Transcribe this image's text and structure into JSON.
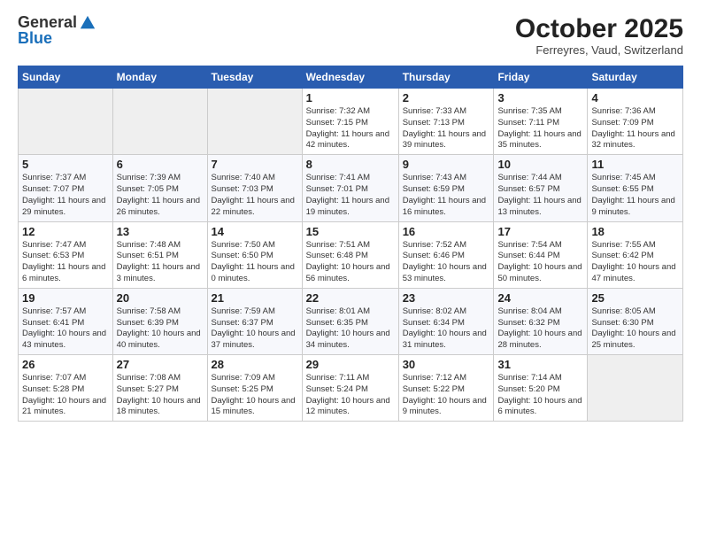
{
  "header": {
    "logo_general": "General",
    "logo_blue": "Blue",
    "month_title": "October 2025",
    "subtitle": "Ferreyres, Vaud, Switzerland"
  },
  "weekdays": [
    "Sunday",
    "Monday",
    "Tuesday",
    "Wednesday",
    "Thursday",
    "Friday",
    "Saturday"
  ],
  "weeks": [
    [
      {
        "day": "",
        "empty": true
      },
      {
        "day": "",
        "empty": true
      },
      {
        "day": "",
        "empty": true
      },
      {
        "day": "1",
        "sunrise": "7:32 AM",
        "sunset": "7:15 PM",
        "daylight": "11 hours and 42 minutes."
      },
      {
        "day": "2",
        "sunrise": "7:33 AM",
        "sunset": "7:13 PM",
        "daylight": "11 hours and 39 minutes."
      },
      {
        "day": "3",
        "sunrise": "7:35 AM",
        "sunset": "7:11 PM",
        "daylight": "11 hours and 35 minutes."
      },
      {
        "day": "4",
        "sunrise": "7:36 AM",
        "sunset": "7:09 PM",
        "daylight": "11 hours and 32 minutes."
      }
    ],
    [
      {
        "day": "5",
        "sunrise": "7:37 AM",
        "sunset": "7:07 PM",
        "daylight": "11 hours and 29 minutes."
      },
      {
        "day": "6",
        "sunrise": "7:39 AM",
        "sunset": "7:05 PM",
        "daylight": "11 hours and 26 minutes."
      },
      {
        "day": "7",
        "sunrise": "7:40 AM",
        "sunset": "7:03 PM",
        "daylight": "11 hours and 22 minutes."
      },
      {
        "day": "8",
        "sunrise": "7:41 AM",
        "sunset": "7:01 PM",
        "daylight": "11 hours and 19 minutes."
      },
      {
        "day": "9",
        "sunrise": "7:43 AM",
        "sunset": "6:59 PM",
        "daylight": "11 hours and 16 minutes."
      },
      {
        "day": "10",
        "sunrise": "7:44 AM",
        "sunset": "6:57 PM",
        "daylight": "11 hours and 13 minutes."
      },
      {
        "day": "11",
        "sunrise": "7:45 AM",
        "sunset": "6:55 PM",
        "daylight": "11 hours and 9 minutes."
      }
    ],
    [
      {
        "day": "12",
        "sunrise": "7:47 AM",
        "sunset": "6:53 PM",
        "daylight": "11 hours and 6 minutes."
      },
      {
        "day": "13",
        "sunrise": "7:48 AM",
        "sunset": "6:51 PM",
        "daylight": "11 hours and 3 minutes."
      },
      {
        "day": "14",
        "sunrise": "7:50 AM",
        "sunset": "6:50 PM",
        "daylight": "11 hours and 0 minutes."
      },
      {
        "day": "15",
        "sunrise": "7:51 AM",
        "sunset": "6:48 PM",
        "daylight": "10 hours and 56 minutes."
      },
      {
        "day": "16",
        "sunrise": "7:52 AM",
        "sunset": "6:46 PM",
        "daylight": "10 hours and 53 minutes."
      },
      {
        "day": "17",
        "sunrise": "7:54 AM",
        "sunset": "6:44 PM",
        "daylight": "10 hours and 50 minutes."
      },
      {
        "day": "18",
        "sunrise": "7:55 AM",
        "sunset": "6:42 PM",
        "daylight": "10 hours and 47 minutes."
      }
    ],
    [
      {
        "day": "19",
        "sunrise": "7:57 AM",
        "sunset": "6:41 PM",
        "daylight": "10 hours and 43 minutes."
      },
      {
        "day": "20",
        "sunrise": "7:58 AM",
        "sunset": "6:39 PM",
        "daylight": "10 hours and 40 minutes."
      },
      {
        "day": "21",
        "sunrise": "7:59 AM",
        "sunset": "6:37 PM",
        "daylight": "10 hours and 37 minutes."
      },
      {
        "day": "22",
        "sunrise": "8:01 AM",
        "sunset": "6:35 PM",
        "daylight": "10 hours and 34 minutes."
      },
      {
        "day": "23",
        "sunrise": "8:02 AM",
        "sunset": "6:34 PM",
        "daylight": "10 hours and 31 minutes."
      },
      {
        "day": "24",
        "sunrise": "8:04 AM",
        "sunset": "6:32 PM",
        "daylight": "10 hours and 28 minutes."
      },
      {
        "day": "25",
        "sunrise": "8:05 AM",
        "sunset": "6:30 PM",
        "daylight": "10 hours and 25 minutes."
      }
    ],
    [
      {
        "day": "26",
        "sunrise": "7:07 AM",
        "sunset": "5:28 PM",
        "daylight": "10 hours and 21 minutes."
      },
      {
        "day": "27",
        "sunrise": "7:08 AM",
        "sunset": "5:27 PM",
        "daylight": "10 hours and 18 minutes."
      },
      {
        "day": "28",
        "sunrise": "7:09 AM",
        "sunset": "5:25 PM",
        "daylight": "10 hours and 15 minutes."
      },
      {
        "day": "29",
        "sunrise": "7:11 AM",
        "sunset": "5:24 PM",
        "daylight": "10 hours and 12 minutes."
      },
      {
        "day": "30",
        "sunrise": "7:12 AM",
        "sunset": "5:22 PM",
        "daylight": "10 hours and 9 minutes."
      },
      {
        "day": "31",
        "sunrise": "7:14 AM",
        "sunset": "5:20 PM",
        "daylight": "10 hours and 6 minutes."
      },
      {
        "day": "",
        "empty": true
      }
    ]
  ]
}
